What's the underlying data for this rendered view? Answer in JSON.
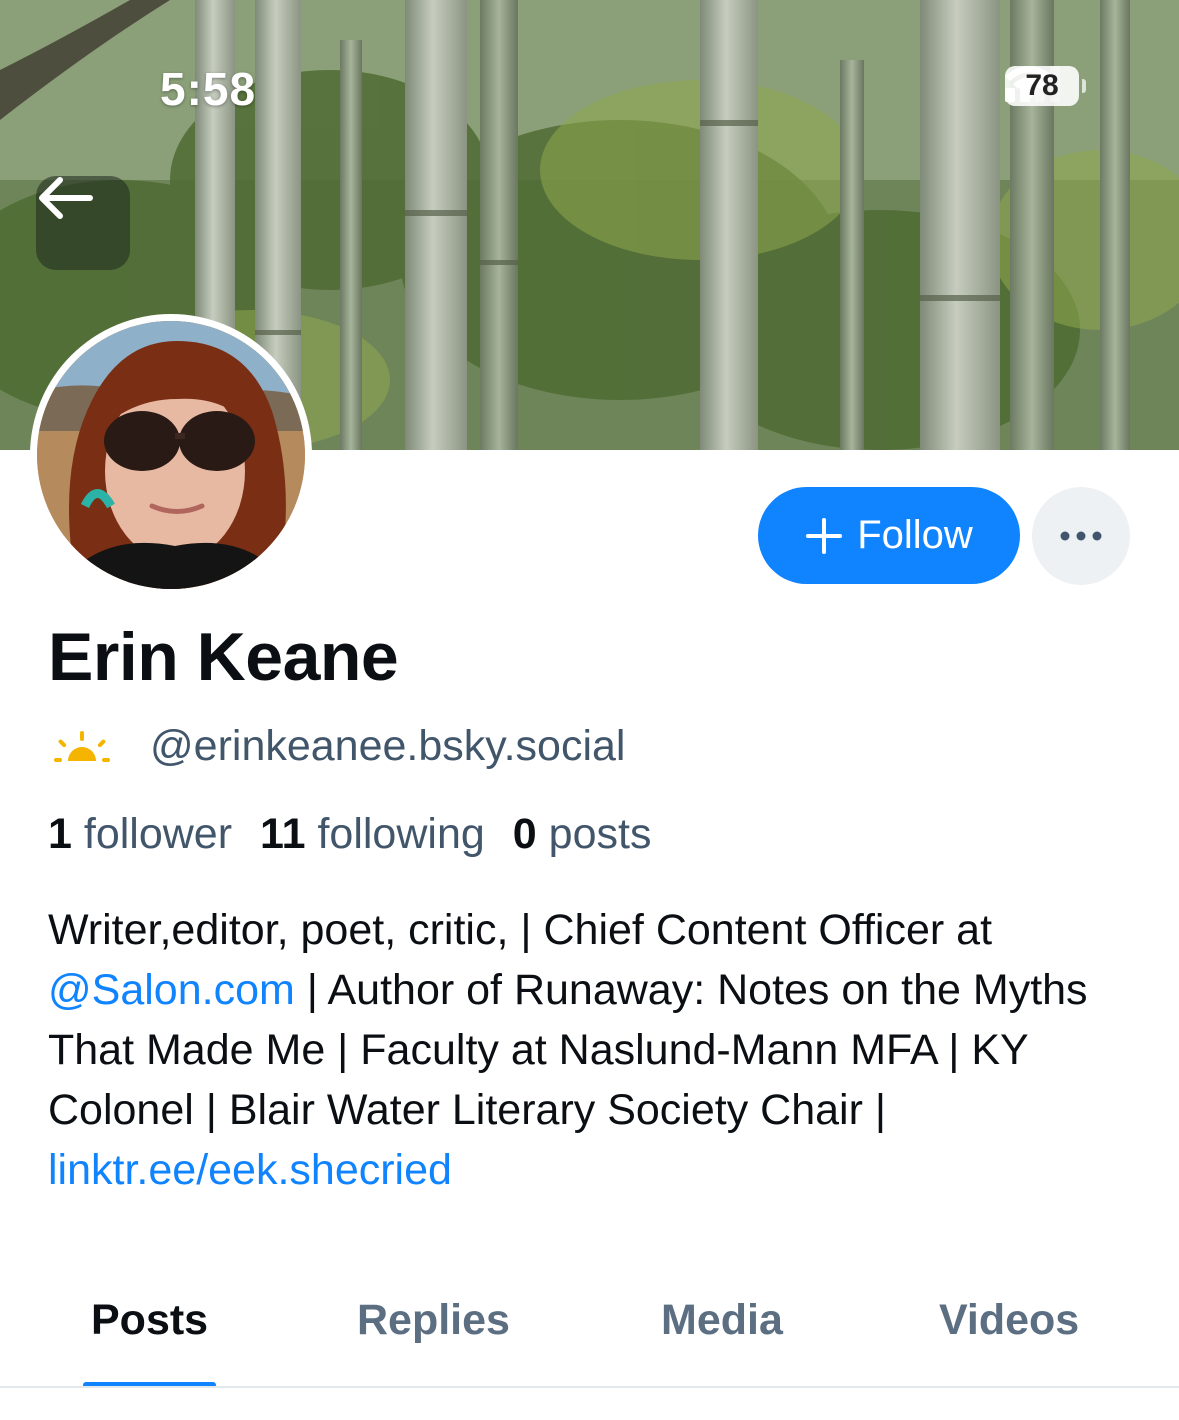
{
  "status_bar": {
    "time": "5:58",
    "battery": "78"
  },
  "profile": {
    "display_name": "Erin Keane",
    "handle": "@erinkeanee.bsky.social",
    "stats": {
      "followers_count": "1",
      "followers_label": "follower",
      "following_count": "11",
      "following_label": "following",
      "posts_count": "0",
      "posts_label": "posts"
    },
    "bio": {
      "line1": "Writer,editor, poet, critic, | Chief Content Officer at",
      "mention": "@Salon.com",
      "part2": " | Author of Runaway: Notes on the Myths That Made Me | Faculty at Naslund-Mann MFA | KY Colonel | Blair Water Literary Society Chair | ",
      "link": "linktr.ee/eek.shecried"
    }
  },
  "actions": {
    "follow_label": "Follow"
  },
  "tabs": [
    {
      "label": "Posts",
      "active": true
    },
    {
      "label": "Replies",
      "active": false
    },
    {
      "label": "Media",
      "active": false
    },
    {
      "label": "Videos",
      "active": false
    }
  ],
  "colors": {
    "accent": "#1083fe",
    "secondary_text": "#42566b",
    "sun_icon": "#f5b400"
  },
  "icons": {
    "back": "arrow-left-icon",
    "follow": "plus-icon",
    "more": "ellipsis-icon",
    "handle_badge": "sunrise-icon"
  }
}
